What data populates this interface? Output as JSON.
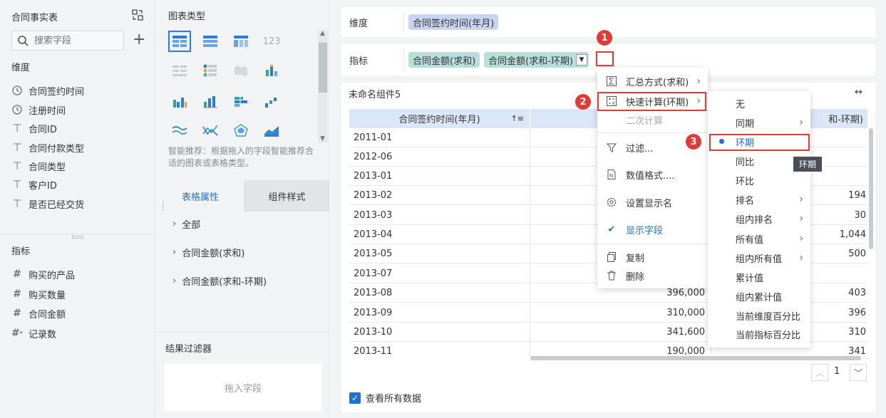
{
  "left": {
    "title": "合同事实表",
    "search_placeholder": "搜索字段",
    "dim_title": "维度",
    "dimensions": [
      {
        "icon": "clock-icon",
        "label": "合同签约时间"
      },
      {
        "icon": "clock-icon",
        "label": "注册时间"
      },
      {
        "icon": "text-type-icon",
        "label": "合同ID"
      },
      {
        "icon": "text-type-icon",
        "label": "合同付款类型"
      },
      {
        "icon": "text-type-icon",
        "label": "合同类型"
      },
      {
        "icon": "text-type-icon",
        "label": "客户ID"
      },
      {
        "icon": "text-type-icon",
        "label": "是否已经交货"
      }
    ],
    "metric_title": "指标",
    "metrics": [
      {
        "icon": "hash-icon",
        "label": "购买的产品"
      },
      {
        "icon": "hash-icon",
        "label": "购买数量"
      },
      {
        "icon": "hash-icon",
        "label": "合同金额"
      },
      {
        "icon": "hash-star-icon",
        "label": "记录数"
      }
    ]
  },
  "middle": {
    "chart_type_title": "图表类型",
    "smart_tip": "智能推荐：根据拖入的字段智能推荐合适的图表或表格类型。",
    "tabs": [
      "表格属性",
      "组件样式"
    ],
    "tree": [
      "全部",
      "合同金额(求和)",
      "合同金额(求和-环期)"
    ],
    "filter_title": "结果过滤器",
    "drop_placeholder": "拖入字段"
  },
  "right": {
    "dimension_label": "维度",
    "dimension_chip": "合同签约时间(年月)",
    "metric_label": "指标",
    "metric_chips": [
      "合同金额(求和)",
      "合同金额(求和-环期)"
    ],
    "component_title": "未命名组件5",
    "table": {
      "headers": [
        "合同签约时间(年月)",
        "合",
        "和-环期)"
      ],
      "rows": [
        [
          "2011-01",
          "",
          ""
        ],
        [
          "2012-06",
          "",
          ""
        ],
        [
          "2013-01",
          "",
          ""
        ],
        [
          "2013-02",
          "",
          "194"
        ],
        [
          "2013-03",
          "",
          "30"
        ],
        [
          "2013-04",
          "",
          "1,044"
        ],
        [
          "2013-05",
          "",
          "500"
        ],
        [
          "2013-07",
          "",
          ""
        ],
        [
          "2013-08",
          "396,000",
          "403"
        ],
        [
          "2013-09",
          "310,000",
          "396"
        ],
        [
          "2013-10",
          "341,600",
          "310"
        ],
        [
          "2013-11",
          "190,000",
          "341"
        ]
      ]
    },
    "page": "1",
    "view_all": "查看所有数据"
  },
  "menu1": {
    "items": [
      "汇总方式(求和)",
      "快速计算(环期)",
      "二次计算",
      "过滤...",
      "数值格式....",
      "设置显示名",
      "显示字段",
      "复制",
      "删除"
    ]
  },
  "menu2": {
    "items": [
      "无",
      "同期",
      "环期",
      "同比",
      "环比",
      "排名",
      "组内排名",
      "所有值",
      "组内所有值",
      "累计值",
      "组内累计值",
      "当前维度百分比",
      "当前指标百分比"
    ]
  },
  "tooltip": "环期",
  "badges": [
    "1",
    "2",
    "3"
  ],
  "colors": {
    "accent": "#1f6fd6",
    "chip_dim": "#c9d5ef",
    "chip_metric": "#b8e0da",
    "red": "#e53935"
  }
}
